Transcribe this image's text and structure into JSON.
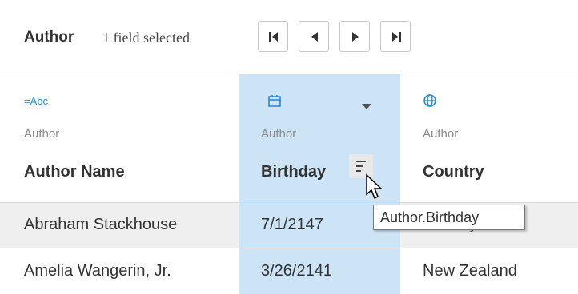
{
  "toolbar": {
    "title": "Author",
    "selection_status": "1 field selected",
    "nav_buttons": [
      "first-page",
      "previous-page",
      "next-page",
      "last-page"
    ]
  },
  "columns": [
    {
      "type_icon": "string-type-icon",
      "type_icon_text": "=Abc",
      "source": "Author",
      "name": "Author Name"
    },
    {
      "type_icon": "calendar-icon",
      "source": "Author",
      "name": "Birthday",
      "has_menu": true
    },
    {
      "type_icon": "globe-icon",
      "source": "Author",
      "name": "Country"
    }
  ],
  "rows": [
    [
      "Abraham Stackhouse",
      "7/1/2147",
      "Norway"
    ],
    [
      "Amelia Wangerin, Jr.",
      "3/26/2141",
      "New Zealand"
    ]
  ],
  "tooltip": {
    "text": "Author.Birthday"
  },
  "colors": {
    "selected_column": "#cde4f7",
    "accent": "#2a8bd3"
  }
}
